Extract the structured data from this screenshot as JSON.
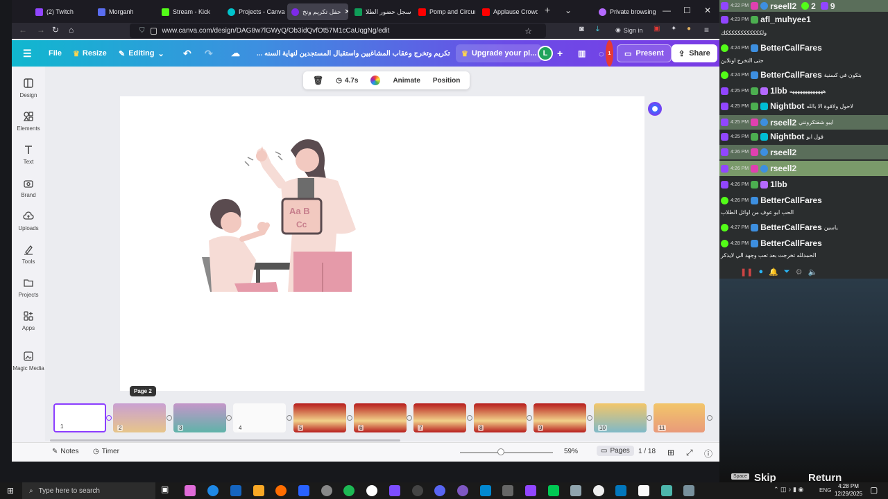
{
  "browser": {
    "tabs": [
      {
        "label": "(2) Twitch",
        "color": "#9146ff"
      },
      {
        "label": "Morganh",
        "color": "#5a6df0"
      },
      {
        "label": "Stream - Kick",
        "color": "#53fc18"
      },
      {
        "label": "Projects - Canva",
        "color": "#00c4cc"
      },
      {
        "label": "حفل تكريم وتخ",
        "color": "#7d2ae8",
        "active": true
      },
      {
        "label": "سجل حضور الطلا",
        "color": "#0f9d58"
      },
      {
        "label": "Pomp and Circum",
        "color": "#ff0000"
      },
      {
        "label": "Applause Crowd C",
        "color": "#ff0000"
      }
    ],
    "private_label": "Private browsing",
    "url": "www.canva.com/design/DAG8w7lGWyQ/Ob3idQvfOt57M1cCaUqgNg/edit",
    "signin_label": "Sign in"
  },
  "canva": {
    "file_label": "File",
    "resize_label": "Resize",
    "editing_label": "Editing",
    "title": "... تكريم وتخرج وعقاب المشاغبين واستقبال المستجدين لنهاية السنه",
    "upgrade_label": "Upgrade your pl...",
    "avatar_letter": "L",
    "comments_badge": "1",
    "present_label": "Present",
    "share_label": "Share",
    "sidebar": [
      "Design",
      "Elements",
      "Text",
      "Brand",
      "Uploads",
      "Tools",
      "Projects",
      "Apps",
      "Magic Media"
    ],
    "context_toolbar": {
      "duration": "4.7s",
      "animate": "Animate",
      "position": "Position"
    },
    "tooltip": "Page 2",
    "thumbnails": [
      "1",
      "2",
      "3",
      "4",
      "5",
      "6",
      "7",
      "8",
      "9",
      "10",
      "11"
    ],
    "footer": {
      "notes": "Notes",
      "timer": "Timer",
      "zoom": "59%",
      "pages_label": "Pages",
      "page_count": "1 / 18"
    }
  },
  "chat": {
    "top_counts": [
      "2",
      "9"
    ],
    "messages": [
      {
        "time": "4:22 PM",
        "user": "rseell2",
        "text": ""
      },
      {
        "time": "4:23 PM",
        "user": "afl_muhyee1",
        "text": ""
      },
      {
        "time": "",
        "user": "",
        "text": "ولككككككككككككك"
      },
      {
        "time": "4:24 PM",
        "user": "BetterCallFares",
        "text": ""
      },
      {
        "time": "",
        "user": "",
        "text": "حتى التخرج اونلاين"
      },
      {
        "time": "4:24 PM",
        "user": "BetterCallFares",
        "text": "بتكون في كسنية"
      },
      {
        "time": "4:25 PM",
        "user": "1lbb",
        "text": "هههههههههههههه"
      },
      {
        "time": "4:25 PM",
        "user": "Nightbot",
        "text": "لاحول ولاقوة الا بالله"
      },
      {
        "time": "4:25 PM",
        "user": "rseell2",
        "text": "ايبو شقتكرونني"
      },
      {
        "time": "4:25 PM",
        "user": "Nightbot",
        "text": "قول ابو"
      },
      {
        "time": "4:26 PM",
        "user": "rseell2",
        "text": ""
      },
      {
        "time": "4:26 PM",
        "user": "rseell2",
        "text": ""
      },
      {
        "time": "4:26 PM",
        "user": "1lbb",
        "text": ""
      },
      {
        "time": "4:26 PM",
        "user": "BetterCallFares",
        "text": ""
      },
      {
        "time": "",
        "user": "",
        "text": "الحب ابو عوف من اوائل الطلاب"
      },
      {
        "time": "4:27 PM",
        "user": "BetterCallFares",
        "text": "ياسين"
      },
      {
        "time": "4:28 PM",
        "user": "BetterCallFares",
        "text": ""
      },
      {
        "time": "",
        "user": "",
        "text": "الحمدلله تخرجت بعد تعب وجهد الي لايذكر"
      }
    ],
    "overlay_skip": "Skip",
    "overlay_return": "Return",
    "overlay_space": "Space"
  },
  "taskbar": {
    "search_placeholder": "Type here to search",
    "lang": "ENG",
    "time": "4:28 PM",
    "date": "12/29/2025"
  }
}
